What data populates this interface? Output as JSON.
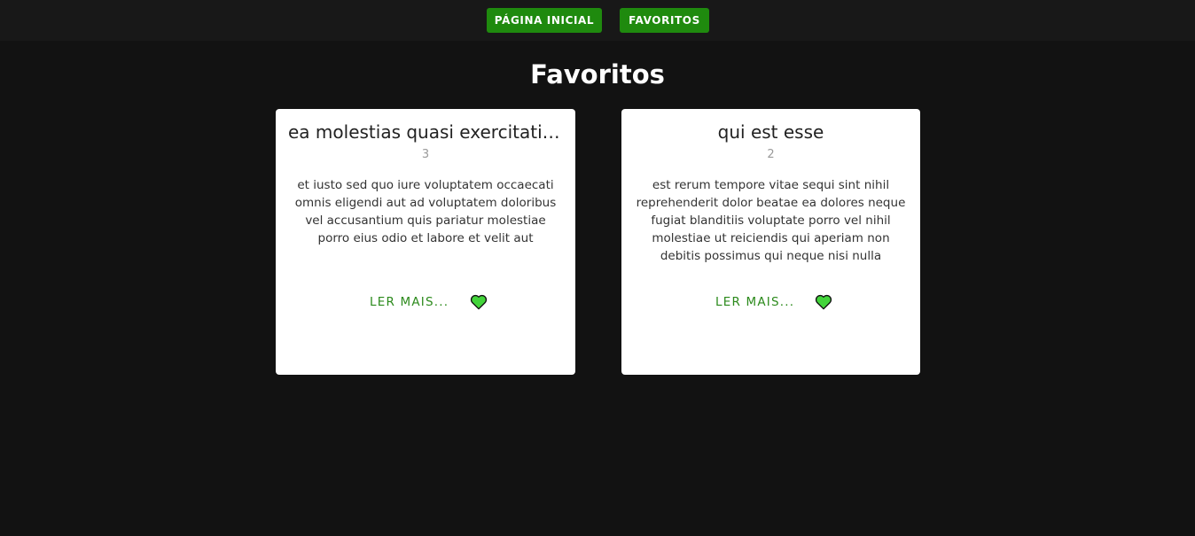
{
  "nav": {
    "home_label": "PÁGINA INICIAL",
    "favorites_label": "FAVORITOS",
    "accent_color": "#1f8a0e"
  },
  "page": {
    "title": "Favoritos",
    "background_color": "#121212"
  },
  "posts": [
    {
      "title": "ea molestias quasi exercitationem repellat qui ipsa sit aut",
      "id": "3",
      "body": "et iusto sed quo iure voluptatem occaecati omnis eligendi aut ad voluptatem doloribus vel accusantium quis pariatur molestiae porro eius odio et labore et velit aut",
      "read_more_label": "LER MAIS...",
      "favorite_icon": "heart-icon",
      "favorited": true
    },
    {
      "title": "qui est esse",
      "id": "2",
      "body": "est rerum tempore vitae sequi sint nihil reprehenderit dolor beatae ea dolores neque fugiat blanditiis voluptate porro vel nihil molestiae ut reiciendis qui aperiam non debitis possimus qui neque nisi nulla",
      "read_more_label": "LER MAIS...",
      "favorite_icon": "heart-icon",
      "favorited": true
    }
  ]
}
